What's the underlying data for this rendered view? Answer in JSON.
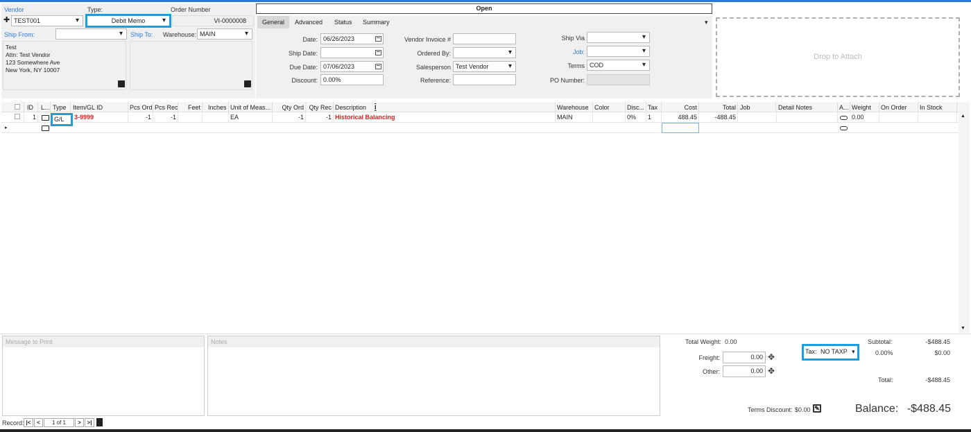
{
  "header": {
    "vendor_label": "Vendor",
    "vendor_value": "TEST001",
    "type_label": "Type:",
    "type_value": "Debit Memo",
    "order_number_label": "Order Number",
    "order_number_value": "VI-0000008",
    "status": "Open",
    "ship_from_label": "Ship From:",
    "ship_to_label": "Ship To:",
    "warehouse_label": "Warehouse:",
    "warehouse_value": "MAIN",
    "address_lines": [
      "Test",
      "Attn: Test Vendor",
      "123 Somewhere Ave",
      "New York, NY 10007"
    ]
  },
  "tabs": [
    "General",
    "Advanced",
    "Status",
    "Summary"
  ],
  "general": {
    "date_label": "Date:",
    "date_value": "06/26/2023",
    "ship_date_label": "Ship Date:",
    "ship_date_value": "",
    "due_date_label": "Due Date:",
    "due_date_value": "07/06/2023",
    "discount_label": "Discount:",
    "discount_value": "0.00%",
    "vendor_invoice_label": "Vendor Invoice #",
    "vendor_invoice_value": "",
    "ordered_by_label": "Ordered By:",
    "ordered_by_value": "",
    "salesperson_label": "Salesperson",
    "salesperson_value": "Test Vendor",
    "reference_label": "Reference:",
    "reference_value": "",
    "ship_via_label": "Ship Via",
    "ship_via_value": "",
    "job_label": "Job:",
    "job_value": "",
    "terms_label": "Terms",
    "terms_value": "COD",
    "po_number_label": "PO Number:",
    "po_number_value": ""
  },
  "attach": {
    "drop_text": "Drop to Attach"
  },
  "grid": {
    "columns": [
      "ID",
      "L...",
      "Type",
      "Item/GL ID",
      "Pcs Ord",
      "Pcs Rec",
      "Feet",
      "Inches",
      "Unit of Meas...",
      "Qty Ord",
      "Qty Rec",
      "Description",
      "Warehouse",
      "Color",
      "Disc...",
      "Tax",
      "Cost",
      "Total",
      "Job",
      "Detail Notes",
      "A...",
      "Weight",
      "On Order",
      "In Stock"
    ],
    "rows": [
      {
        "id": "1",
        "type": "G/L",
        "item": "3-9999",
        "pcs_ord": "-1",
        "pcs_rec": "-1",
        "feet": "",
        "inches": "",
        "uom": "EA",
        "qty_ord": "-1",
        "qty_rec": "-1",
        "description": "Historical Balancing",
        "warehouse": "MAIN",
        "color": "",
        "disc": "0%",
        "tax": "1",
        "cost": "488.45",
        "total": "-488.45",
        "job": "",
        "detail_notes": "",
        "weight": "0.00",
        "on_order": "",
        "in_stock": ""
      }
    ]
  },
  "bottom": {
    "message_label": "Message to Print",
    "notes_label": "Notes",
    "total_weight_label": "Total Weight:",
    "total_weight_value": "0.00",
    "freight_label": "Freight:",
    "freight_value": "0.00",
    "other_label": "Other:",
    "other_value": "0.00",
    "tax_label": "Tax:",
    "tax_value": "NO TAXP",
    "subtotal_label": "Subtotal:",
    "subtotal_value": "-$488.45",
    "tax_pct": "0.00%",
    "tax_amount": "$0.00",
    "total_label": "Total:",
    "total_value": "-$488.45",
    "terms_discount_label": "Terms Discount:",
    "terms_discount_value": "$0.00",
    "balance_label": "Balance:",
    "balance_value": "-$488.45"
  },
  "record_nav": {
    "label": "Record:",
    "position": "1 of 1"
  },
  "colors": {
    "accent": "#2a7ad6",
    "highlight": "#1a9ee2",
    "red_text": "#e02020"
  }
}
